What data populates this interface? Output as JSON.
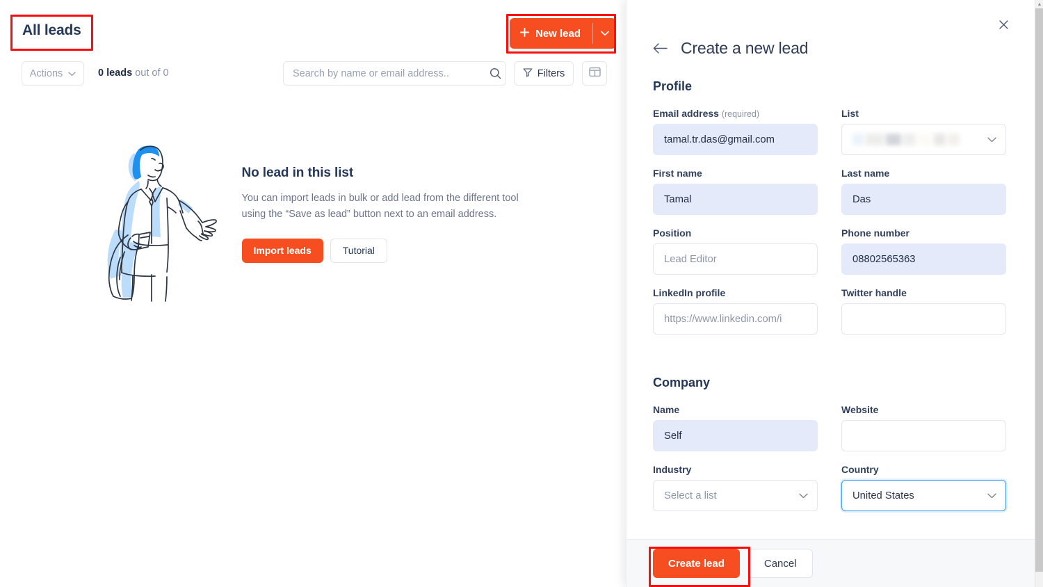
{
  "left": {
    "page_title": "All leads",
    "new_lead": {
      "label": "New lead",
      "plus": "+",
      "chevron": "chevron-down"
    },
    "toolbar": {
      "actions_label": "Actions",
      "count_bold": "0 leads",
      "count_rest": " out of 0",
      "search_placeholder": "Search by name or email address..",
      "search_value": "",
      "filters_label": "Filters",
      "columns_icon": "columns-icon"
    },
    "empty_state": {
      "heading": "No lead in this list",
      "body": "You can import leads in bulk or add lead from the different tool using the “Save as lead” button next to an email address.",
      "import_label": "Import leads",
      "tutorial_label": "Tutorial",
      "illustration": "man-gesturing-illustration"
    }
  },
  "panel": {
    "title": "Create a new lead",
    "back_icon": "arrow-left-icon",
    "close_icon": "close-icon",
    "sections": {
      "profile": "Profile",
      "company": "Company"
    },
    "fields": {
      "email": {
        "label": "Email address",
        "required_note": "(required)",
        "value": "tamal.tr.das@gmail.com",
        "state": "filled"
      },
      "list": {
        "label": "List",
        "value": "",
        "state": "redacted",
        "chevron": "chevron-down"
      },
      "first_name": {
        "label": "First name",
        "value": "Tamal",
        "state": "filled"
      },
      "last_name": {
        "label": "Last name",
        "value": "Das",
        "state": "filled"
      },
      "position": {
        "label": "Position",
        "value": "Lead Editor",
        "state": "placeholder"
      },
      "phone": {
        "label": "Phone number",
        "value": "08802565363",
        "state": "filled"
      },
      "linkedin": {
        "label": "LinkedIn profile",
        "value": "https://www.linkedin.com/i",
        "state": "placeholder"
      },
      "twitter": {
        "label": "Twitter handle",
        "value": "",
        "state": "empty"
      },
      "company_name": {
        "label": "Name",
        "value": "Self",
        "state": "filled"
      },
      "website": {
        "label": "Website",
        "value": "",
        "state": "empty"
      },
      "industry": {
        "label": "Industry",
        "value": "Select a list",
        "state": "placeholder",
        "chevron": "chevron-down"
      },
      "country": {
        "label": "Country",
        "value": "United States",
        "state": "focused",
        "chevron": "chevron-down"
      }
    },
    "footer": {
      "create_label": "Create lead",
      "cancel_label": "Cancel"
    }
  },
  "annotations": {
    "color": "#fc0d0d",
    "boxes": [
      "all-leads-title",
      "new-lead-button",
      "create-lead-button"
    ]
  },
  "colors": {
    "accent_orange": "#f64e21",
    "filled_field_bg": "#e4eafa",
    "focus_blue": "#3d9bf5",
    "text_dark": "#253858"
  }
}
